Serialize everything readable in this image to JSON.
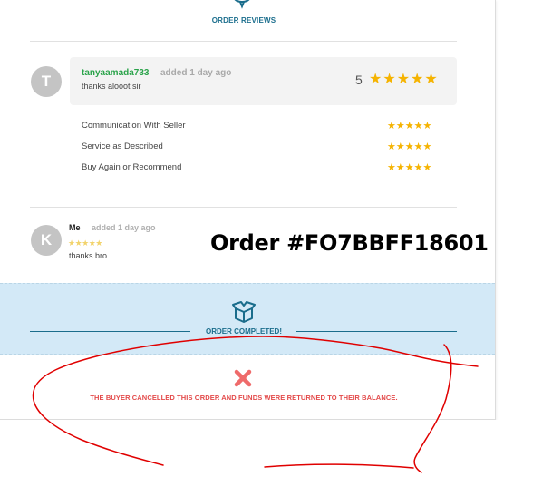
{
  "reviews": {
    "title": "ORDER REVIEWS",
    "icon": "speech-bubble-icon"
  },
  "buyer_review": {
    "avatar_letter": "T",
    "username": "tanyaamada733",
    "time": "added 1 day ago",
    "message": "thanks alooot sir",
    "rating": "5",
    "stars": "★★★★★",
    "criteria": [
      {
        "label": "Communication With Seller",
        "stars": "★★★★★"
      },
      {
        "label": "Service as Described",
        "stars": "★★★★★"
      },
      {
        "label": "Buy Again or Recommend",
        "stars": "★★★★★"
      }
    ]
  },
  "seller_review": {
    "avatar_letter": "K",
    "name": "Me",
    "time": "added 1 day ago",
    "stars": "★★★★★",
    "message": "thanks bro.."
  },
  "order": {
    "id_label": "Order #FO7BBFF18601"
  },
  "status": {
    "completed_label": "ORDER COMPLETED!",
    "cancel_message": "THE BUYER CANCELLED THIS ORDER AND FUNDS WERE RETURNED TO THEIR BALANCE."
  },
  "colors": {
    "accent": "#1a6d8c",
    "username_green": "#2aa34a",
    "star": "#f5b301",
    "band": "#d3e9f7",
    "cancel_red": "#e34a4a",
    "scribble": "#e00000"
  }
}
